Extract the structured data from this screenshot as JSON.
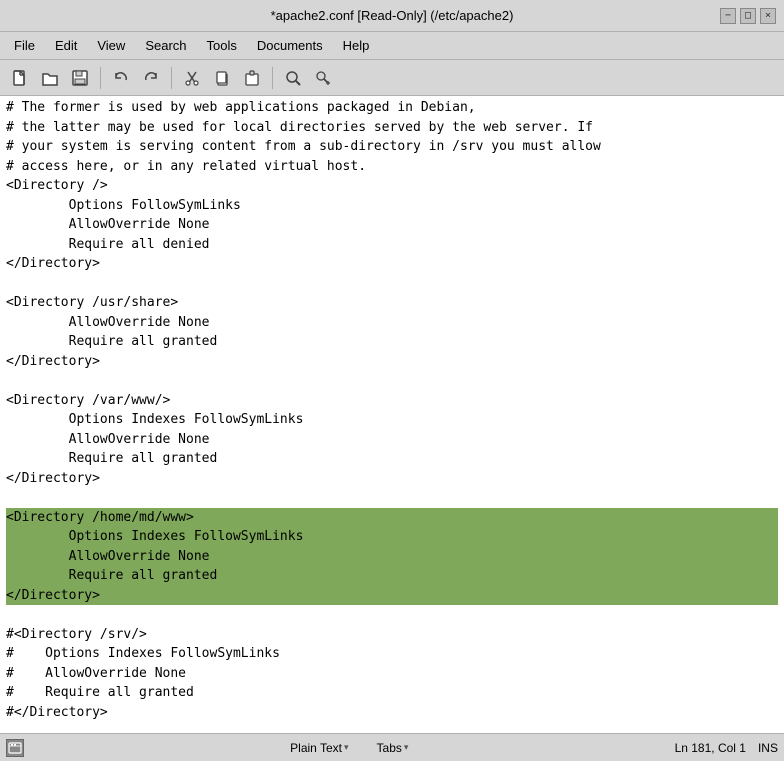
{
  "titleBar": {
    "title": "*apache2.conf [Read-Only] (/etc/apache2)",
    "minimizeLabel": "−",
    "maximizeLabel": "□",
    "closeLabel": "×"
  },
  "menuBar": {
    "items": [
      "File",
      "Edit",
      "View",
      "Search",
      "Tools",
      "Documents",
      "Help"
    ]
  },
  "toolbar": {
    "buttons": [
      {
        "name": "new-file",
        "icon": "⊞"
      },
      {
        "name": "open-file",
        "icon": "⬜"
      },
      {
        "name": "save-file",
        "icon": "💾"
      },
      {
        "name": "undo",
        "icon": "↩"
      },
      {
        "name": "redo",
        "icon": "↪"
      },
      {
        "name": "cut",
        "icon": "✂"
      },
      {
        "name": "copy",
        "icon": "⧉"
      },
      {
        "name": "paste",
        "icon": "📋"
      },
      {
        "name": "find",
        "icon": "🔍"
      },
      {
        "name": "find-replace",
        "icon": "↔"
      }
    ]
  },
  "editor": {
    "lines": [
      "# The former is used by web applications packaged in Debian,",
      "# the latter may be used for local directories served by the web server. If",
      "# your system is serving content from a sub-directory in /srv you must allow",
      "# access here, or in any related virtual host.",
      "<Directory />",
      "        Options FollowSymLinks",
      "        AllowOverride None",
      "        Require all denied",
      "</Directory>",
      "",
      "<Directory /usr/share>",
      "        AllowOverride None",
      "        Require all granted",
      "</Directory>",
      "",
      "<Directory /var/www/>",
      "        Options Indexes FollowSymLinks",
      "        AllowOverride None",
      "        Require all granted",
      "</Directory>",
      "",
      "<Directory /home/md/www>",
      "        Options Indexes FollowSymLinks",
      "        AllowOverride None",
      "        Require all granted",
      "</Directory>",
      "",
      "#<Directory /srv/>",
      "#    Options Indexes FollowSymLinks",
      "#    AllowOverride None",
      "#    Require all granted",
      "#</Directory>"
    ],
    "highlightStart": 21,
    "highlightEnd": 25
  },
  "statusBar": {
    "leftIcon": "☰",
    "plainTextLabel": "Plain Text",
    "plainTextArrow": "▾",
    "tabsLabel": "Tabs",
    "tabsArrow": "▾",
    "position": "Ln 181, Col 1",
    "mode": "INS"
  }
}
